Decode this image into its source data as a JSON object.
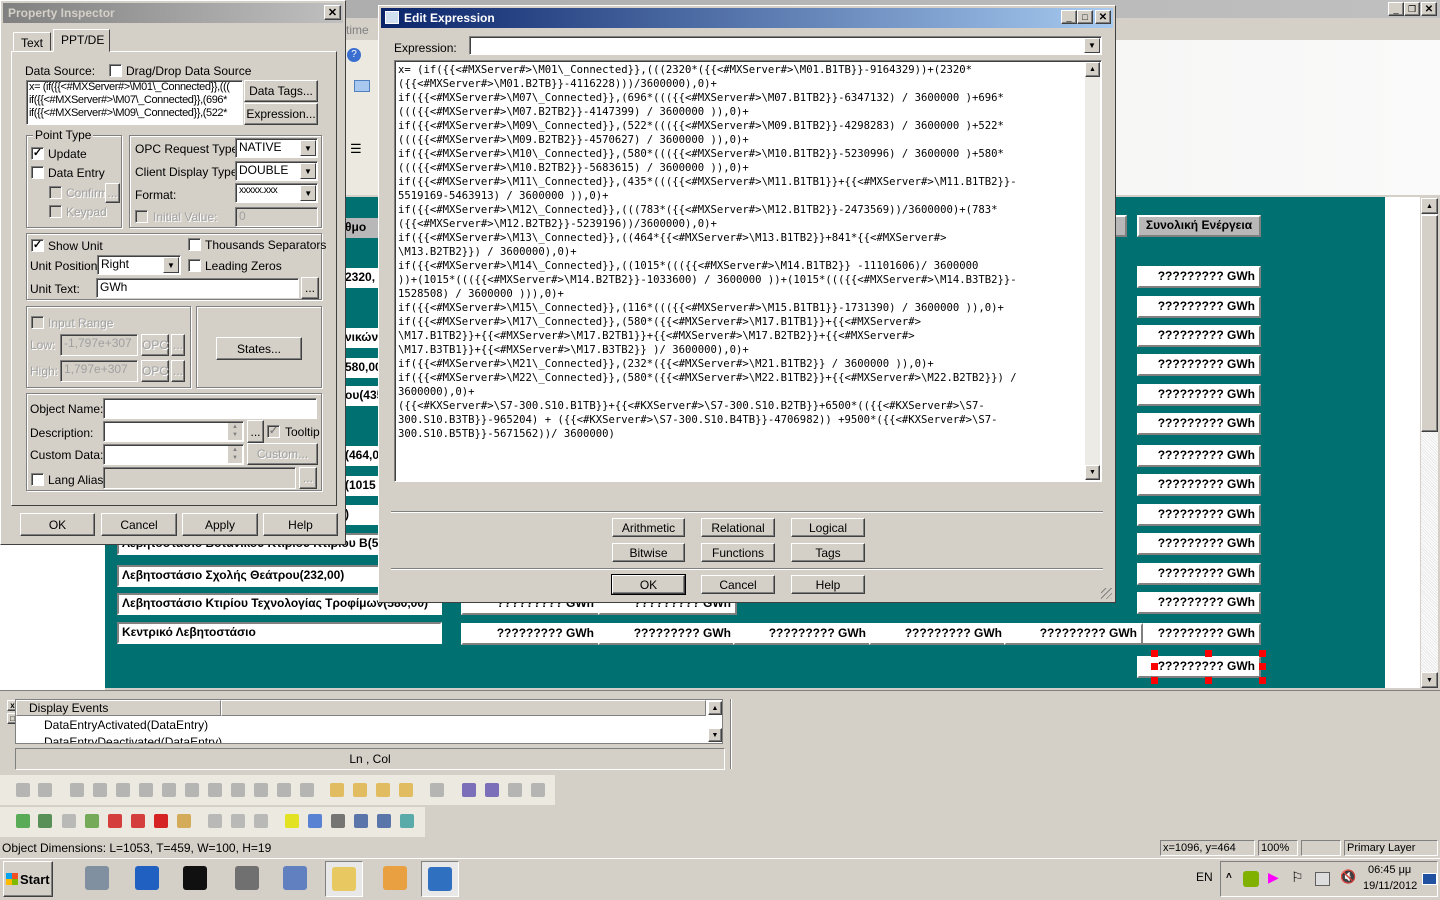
{
  "background": {
    "menu_fragment": "time",
    "canvas_fragments": [
      "θμο",
      "2320,",
      "νικών",
      "580,00",
      "ου(435",
      "(464,0",
      "(1015",
      ")"
    ],
    "left_labels": [
      "Λεβητοστάσιο Βοτανικού Κτιρίου Κτιρίου B(5",
      "Λεβητοστάσιο Σχολής Θεάτρου(232,00)",
      "Λεβητοστάσιο Κτιρίου Τεχνολογίας Τροφίμων(580,00)",
      "Κεντρικό Λεβητοστάσιο"
    ],
    "total_header": "Συνολική Ενέργεια",
    "value_text": "????????? GWh",
    "teal_color": "#007070"
  },
  "property_inspector": {
    "title": "Property Inspector",
    "tabs": [
      "Text",
      "PPT/DE"
    ],
    "active_tab": "PPT/DE",
    "data_source_label": "Data Source:",
    "drag_drop_label": "Drag/Drop Data Source",
    "drag_drop_checked": false,
    "data_source_lines": [
      "x= (if({{<#MXServer#>\\M01\\_Connected}},(((",
      "if({{<#MXServer#>\\M07\\_Connected}},(696*",
      "if({{<#MXServer#>\\M09\\_Connected}},(522*"
    ],
    "data_tags_button": "Data Tags...",
    "expression_button": "Expression...",
    "point_type_title": "Point Type",
    "update_label": "Update",
    "update_checked": true,
    "data_entry_label": "Data Entry",
    "data_entry_checked": false,
    "confirm_label": "Confirm",
    "keypad_label": "Keypad",
    "ellipsis": "...",
    "opc_request_label": "OPC Request Type:",
    "opc_request_value": "NATIVE",
    "client_display_label": "Client Display Type:",
    "client_display_value": "DOUBLE",
    "format_label": "Format:",
    "format_value": "xxxxx.xxx",
    "initial_value_label": "Initial Value:",
    "initial_value": "0",
    "show_unit_label": "Show Unit",
    "show_unit_checked": true,
    "thousands_label": "Thousands Separators",
    "unit_position_label": "Unit Position:",
    "unit_position_value": "Right",
    "leading_zeros_label": "Leading Zeros",
    "unit_text_label": "Unit Text:",
    "unit_text_value": "GWh",
    "input_range_label": "Input Range",
    "low_label": "Low:",
    "low_value": "-1,797e+307",
    "high_label": "High:",
    "high_value": "1,797e+307",
    "opc_button": "OPC",
    "states_button": "States...",
    "object_name_label": "Object Name:",
    "description_label": "Description:",
    "tooltip_label": "Tooltip",
    "tooltip_checked": true,
    "custom_data_label": "Custom Data:",
    "custom_button": "Custom...",
    "lang_alias_label": "Lang Alias:",
    "buttons": {
      "ok": "OK",
      "cancel": "Cancel",
      "apply": "Apply",
      "help": "Help"
    }
  },
  "edit_expression": {
    "title": "Edit Expression",
    "expression_label": "Expression:",
    "expression_value": "",
    "lines": [
      "x= (if({{<#MXServer#>\\M01\\_Connected}},(((2320*({{<#MXServer#>\\M01.B1TB}}-9164329))+(2320*",
      "({{<#MXServer#>\\M01.B2TB}}-4116228)))/3600000),0)+",
      "if({{<#MXServer#>\\M07\\_Connected}},(696*((({{<#MXServer#>\\M07.B1TB2}}-6347132) / 3600000 )+696*",
      "((({{<#MXServer#>\\M07.B2TB2}}-4147399) / 3600000 )),0)+",
      "if({{<#MXServer#>\\M09\\_Connected}},(522*((({{<#MXServer#>\\M09.B1TB2}}-4298283) / 3600000 )+522*",
      "((({{<#MXServer#>\\M09.B2TB2}}-4570627) / 3600000 )),0)+",
      "if({{<#MXServer#>\\M10\\_Connected}},(580*((({{<#MXServer#>\\M10.B1TB2}}-5230996) / 3600000 )+580*",
      "((({{<#MXServer#>\\M10.B2TB2}}-5683615) / 3600000 )),0)+",
      "if({{<#MXServer#>\\M11\\_Connected}},(435*((({{<#MXServer#>\\M11.B1TB1}}+{{<#MXServer#>\\M11.B1TB2}}-",
      "5519169-5463913) / 3600000 )),0)+",
      "if({{<#MXServer#>\\M12\\_Connected}},(((783*({{<#MXServer#>\\M12.B1TB2}}-2473569))/3600000)+(783*",
      "({{<#MXServer#>\\M12.B2TB2}}-5239196))/3600000),0)+",
      "if({{<#MXServer#>\\M13\\_Connected}},((464*{{<#MXServer#>\\M13.B1TB2}}+841*{{<#MXServer#>",
      "\\M13.B2TB2}}) / 3600000),0)+",
      "if({{<#MXServer#>\\M14\\_Connected}},((1015*((({{<#MXServer#>\\M14.B1TB2}} -11101606)/ 3600000",
      "))+(1015*((({{<#MXServer#>\\M14.B2TB2}}-1033600) / 3600000 ))+(1015*((({{<#MXServer#>\\M14.B3TB2}}-",
      "1528508) / 3600000 ))),0)+",
      "if({{<#MXServer#>\\M15\\_Connected}},(116*((({{<#MXServer#>\\M15.B1TB1}}-1731390) / 3600000 )),0)+",
      "if({{<#MXServer#>\\M17\\_Connected}},(580*({{<#MXServer#>\\M17.B1TB1}}+{{<#MXServer#>",
      "\\M17.B1TB2}}+{{<#MXServer#>\\M17.B2TB1}}+{{<#MXServer#>\\M17.B2TB2}}+{{<#MXServer#>",
      "\\M17.B3TB1}}+{{<#MXServer#>\\M17.B3TB2}} )/ 3600000),0)+",
      "if({{<#MXServer#>\\M21\\_Connected}},(232*({{<#MXServer#>\\M21.B1TB2}} / 3600000 )),0)+",
      "if({{<#MXServer#>\\M22\\_Connected}},(580*({{<#MXServer#>\\M22.B1TB2}}+{{<#MXServer#>\\M22.B2TB2}}) /",
      "3600000),0)+",
      "({{<#KXServer#>\\S7-300.S10.B1TB}}+{{<#KXServer#>\\S7-300.S10.B2TB}}+6500*(({{<#KXServer#>\\S7-",
      "300.S10.B3TB}}-965204) + ({{<#KXServer#>\\S7-300.S10.B4TB}}-4706982)) +9500*({{<#KXServer#>\\S7-",
      "300.S10.B5TB}}-5671562))/ 3600000)"
    ],
    "operator_buttons": [
      "Arithmetic",
      "Relational",
      "Logical",
      "Bitwise",
      "Functions",
      "Tags"
    ],
    "buttons": {
      "ok": "OK",
      "cancel": "Cancel",
      "help": "Help"
    }
  },
  "events_panel": {
    "header": "Display Events",
    "items": [
      "DataEntryActivated(DataEntry)",
      "DataEntryDeactivated(DataEntry)"
    ],
    "ln_col": "Ln , Col"
  },
  "status_bar": {
    "object_dimensions": "Object Dimensions: L=1053, T=459, W=100, H=19",
    "cursor": "x=1096, y=464",
    "zoom": "100%",
    "empty": "",
    "layer": "Primary Layer"
  },
  "taskbar": {
    "start": "Start",
    "apps": [
      "server-manager-icon",
      "powershell-icon",
      "cmd-icon",
      "server-chart-icon",
      "trend-chart-icon",
      "explorer-icon",
      "paint-icon",
      "hmi-app-icon"
    ],
    "language": "EN",
    "time": "06:45 μμ",
    "date": "19/11/2012"
  }
}
